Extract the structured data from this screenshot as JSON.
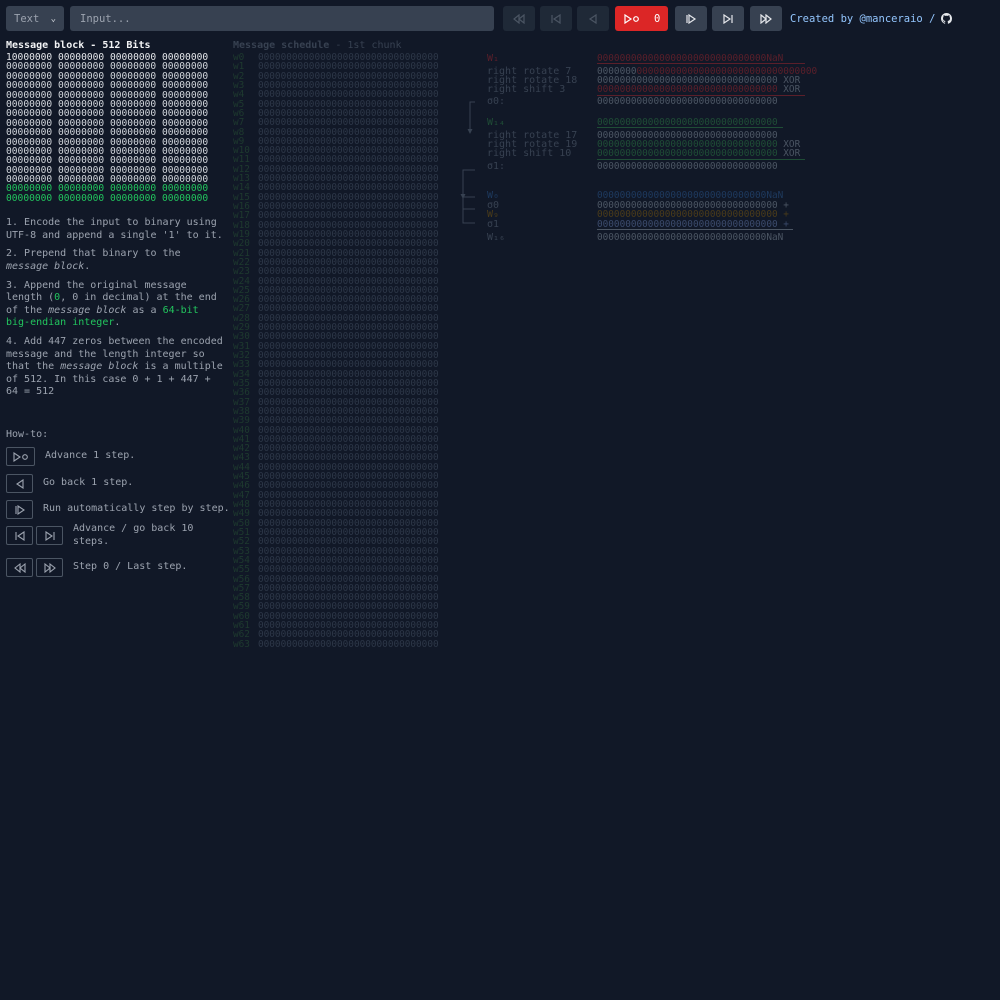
{
  "toolbar": {
    "mode": "Text",
    "input_placeholder": "Input...",
    "step_count": "0",
    "credit": "Created by @manceraio /"
  },
  "left": {
    "title": "Message block - 512 Bits",
    "bits": [
      "10000000 00000000 00000000 00000000",
      "00000000 00000000 00000000 00000000",
      "00000000 00000000 00000000 00000000",
      "00000000 00000000 00000000 00000000",
      "00000000 00000000 00000000 00000000",
      "00000000 00000000 00000000 00000000",
      "00000000 00000000 00000000 00000000",
      "00000000 00000000 00000000 00000000",
      "00000000 00000000 00000000 00000000",
      "00000000 00000000 00000000 00000000",
      "00000000 00000000 00000000 00000000",
      "00000000 00000000 00000000 00000000",
      "00000000 00000000 00000000 00000000",
      "00000000 00000000 00000000 00000000",
      "00000000 00000000 00000000 00000000",
      "00000000 00000000 00000000 00000000"
    ],
    "step1": "1. Encode the input to binary using UTF-8 and append a single '1' to it.",
    "step2_a": "2. Prepend that binary to the ",
    "step2_em": "message block",
    "step2_b": ".",
    "step3_a": "3. Append the original message length (",
    "step3_g1": "0",
    "step3_b": ", 0 in decimal) at the end of the ",
    "step3_em": "message block",
    "step3_c": " as a ",
    "step3_g2": "64-bit big-endian integer",
    "step3_d": ".",
    "step4_a": "4. Add 447 zeros between the encoded message and the length integer so that the ",
    "step4_em": "message block",
    "step4_b": " is a multiple of 512. In this case 0 + 1 + 447 + 64 = 512",
    "howto_title": "How-to:",
    "howto": [
      {
        "text": "Advance 1 step."
      },
      {
        "text": "Go back 1 step."
      },
      {
        "text": "Run automatically step by step."
      },
      {
        "text": "Advance / go back 10 steps."
      },
      {
        "text": "Step 0 / Last step."
      }
    ]
  },
  "schedule": {
    "title": "Message schedule",
    "subtitle": " - 1st chunk",
    "words": [
      {
        "label": "w0",
        "value": "00000000000000000000000000000000"
      },
      {
        "label": "w1",
        "value": "00000000000000000000000000000000"
      },
      {
        "label": "w2",
        "value": "00000000000000000000000000000000"
      },
      {
        "label": "w3",
        "value": "00000000000000000000000000000000"
      },
      {
        "label": "w4",
        "value": "00000000000000000000000000000000"
      },
      {
        "label": "w5",
        "value": "00000000000000000000000000000000"
      },
      {
        "label": "w6",
        "value": "00000000000000000000000000000000"
      },
      {
        "label": "w7",
        "value": "00000000000000000000000000000000"
      },
      {
        "label": "w8",
        "value": "00000000000000000000000000000000"
      },
      {
        "label": "w9",
        "value": "00000000000000000000000000000000"
      },
      {
        "label": "w10",
        "value": "00000000000000000000000000000000"
      },
      {
        "label": "w11",
        "value": "00000000000000000000000000000000"
      },
      {
        "label": "w12",
        "value": "00000000000000000000000000000000"
      },
      {
        "label": "w13",
        "value": "00000000000000000000000000000000"
      },
      {
        "label": "w14",
        "value": "00000000000000000000000000000000"
      },
      {
        "label": "w15",
        "value": "00000000000000000000000000000000"
      },
      {
        "label": "w16",
        "value": "00000000000000000000000000000000"
      },
      {
        "label": "w17",
        "value": "00000000000000000000000000000000"
      },
      {
        "label": "w18",
        "value": "00000000000000000000000000000000"
      },
      {
        "label": "w19",
        "value": "00000000000000000000000000000000"
      },
      {
        "label": "w20",
        "value": "00000000000000000000000000000000"
      },
      {
        "label": "w21",
        "value": "00000000000000000000000000000000"
      },
      {
        "label": "w22",
        "value": "00000000000000000000000000000000"
      },
      {
        "label": "w23",
        "value": "00000000000000000000000000000000"
      },
      {
        "label": "w24",
        "value": "00000000000000000000000000000000"
      },
      {
        "label": "w25",
        "value": "00000000000000000000000000000000"
      },
      {
        "label": "w26",
        "value": "00000000000000000000000000000000"
      },
      {
        "label": "w27",
        "value": "00000000000000000000000000000000"
      },
      {
        "label": "w28",
        "value": "00000000000000000000000000000000"
      },
      {
        "label": "w29",
        "value": "00000000000000000000000000000000"
      },
      {
        "label": "w30",
        "value": "00000000000000000000000000000000"
      },
      {
        "label": "w31",
        "value": "00000000000000000000000000000000"
      },
      {
        "label": "w32",
        "value": "00000000000000000000000000000000"
      },
      {
        "label": "w33",
        "value": "00000000000000000000000000000000"
      },
      {
        "label": "w34",
        "value": "00000000000000000000000000000000"
      },
      {
        "label": "w35",
        "value": "00000000000000000000000000000000"
      },
      {
        "label": "w36",
        "value": "00000000000000000000000000000000"
      },
      {
        "label": "w37",
        "value": "00000000000000000000000000000000"
      },
      {
        "label": "w38",
        "value": "00000000000000000000000000000000"
      },
      {
        "label": "w39",
        "value": "00000000000000000000000000000000"
      },
      {
        "label": "w40",
        "value": "00000000000000000000000000000000"
      },
      {
        "label": "w41",
        "value": "00000000000000000000000000000000"
      },
      {
        "label": "w42",
        "value": "00000000000000000000000000000000"
      },
      {
        "label": "w43",
        "value": "00000000000000000000000000000000"
      },
      {
        "label": "w44",
        "value": "00000000000000000000000000000000"
      },
      {
        "label": "w45",
        "value": "00000000000000000000000000000000"
      },
      {
        "label": "w46",
        "value": "00000000000000000000000000000000"
      },
      {
        "label": "w47",
        "value": "00000000000000000000000000000000"
      },
      {
        "label": "w48",
        "value": "00000000000000000000000000000000"
      },
      {
        "label": "w49",
        "value": "00000000000000000000000000000000"
      },
      {
        "label": "w50",
        "value": "00000000000000000000000000000000"
      },
      {
        "label": "w51",
        "value": "00000000000000000000000000000000"
      },
      {
        "label": "w52",
        "value": "00000000000000000000000000000000"
      },
      {
        "label": "w53",
        "value": "00000000000000000000000000000000"
      },
      {
        "label": "w54",
        "value": "00000000000000000000000000000000"
      },
      {
        "label": "w55",
        "value": "00000000000000000000000000000000"
      },
      {
        "label": "w56",
        "value": "00000000000000000000000000000000"
      },
      {
        "label": "w57",
        "value": "00000000000000000000000000000000"
      },
      {
        "label": "w58",
        "value": "00000000000000000000000000000000"
      },
      {
        "label": "w59",
        "value": "00000000000000000000000000000000"
      },
      {
        "label": "w60",
        "value": "00000000000000000000000000000000"
      },
      {
        "label": "w61",
        "value": "00000000000000000000000000000000"
      },
      {
        "label": "w62",
        "value": "00000000000000000000000000000000"
      },
      {
        "label": "w63",
        "value": "00000000000000000000000000000000"
      }
    ]
  },
  "calc": {
    "w1_label": "W₁",
    "w1_value": "000000000000000000000000000000NaN",
    "rr7_label": "right rotate 7",
    "rr7_value": "00000000000000000000000000000000",
    "rr18_label": "right rotate 18",
    "rr18_value": "00000000000000000000000000000000",
    "rs3_label": "right shift 3",
    "rs3_value": "00000000000000000000000000000000",
    "s0_label": "σ0:",
    "s0_value": "00000000000000000000000000000000",
    "w14_label": "W₁₄",
    "w14_value": "00000000000000000000000000000000",
    "rr17_label": "right rotate 17",
    "rr17_value": "00000000000000000000000000000000",
    "rr19_label": "right rotate 19",
    "rr19_value": "00000000000000000000000000000000",
    "rs10_label": "right shift 10",
    "rs10_value": "00000000000000000000000000000000",
    "s1_label": "σ1:",
    "s1_value": "00000000000000000000000000000000",
    "w0_label": "W₀",
    "w0_value": "000000000000000000000000000000NaN",
    "sig0_label": "σ0",
    "sig0_value": "00000000000000000000000000000000 +",
    "w9_label": "W₉",
    "w9_value": "00000000000000000000000000000000 +",
    "sig1_label": "σ1",
    "sig1_value": "00000000000000000000000000000000 +",
    "w16_label": "W₁₆",
    "w16_value": "000000000000000000000000000000NaN",
    "xor": "XOR"
  },
  "colors": {
    "accent_red": "#dc2626",
    "green": "#22c55e",
    "link": "#93c5fd"
  }
}
